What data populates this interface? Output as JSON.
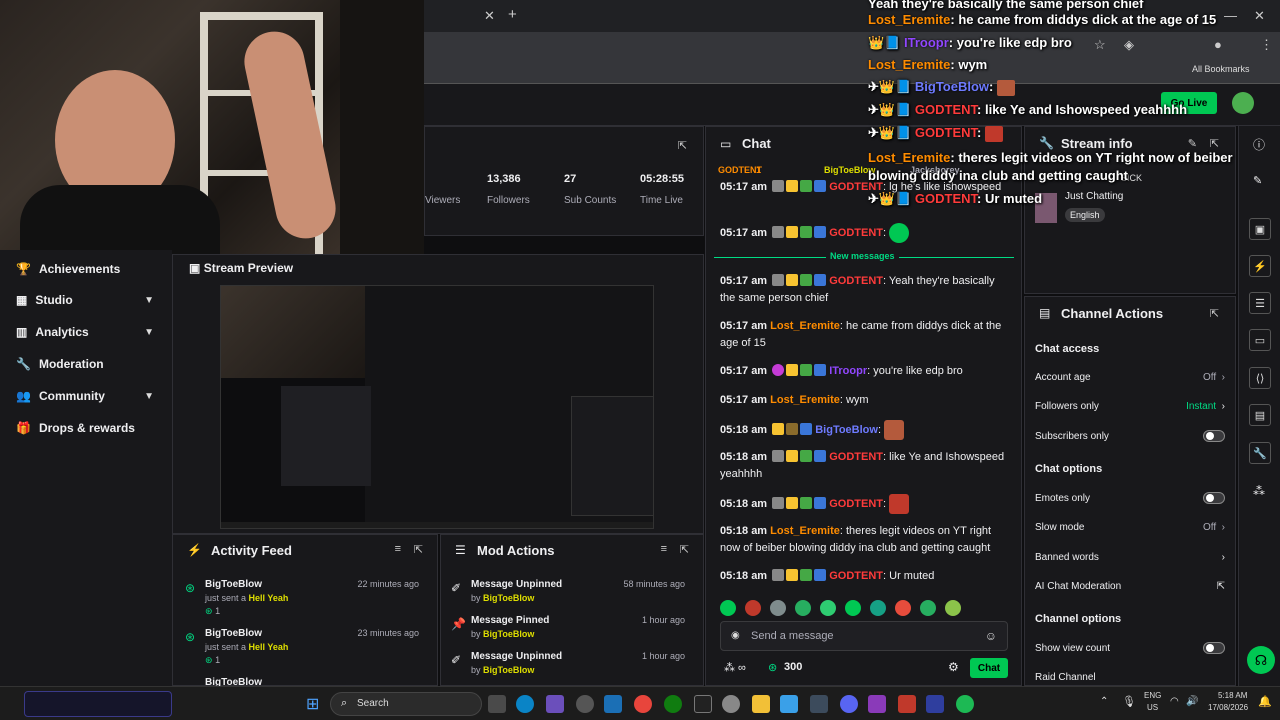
{
  "browser": {
    "bookmarks_label": "All Bookmarks",
    "go_live_label": "Go Live"
  },
  "sidebar": {
    "items": [
      {
        "label": "Achievements",
        "icon": "trophy-icon"
      },
      {
        "label": "Studio",
        "icon": "studio-icon"
      },
      {
        "label": "Analytics",
        "icon": "chart-icon"
      },
      {
        "label": "Moderation",
        "icon": "wrench-icon"
      },
      {
        "label": "Community",
        "icon": "people-icon"
      },
      {
        "label": "Drops & rewards",
        "icon": "gift-icon"
      }
    ]
  },
  "stats": {
    "viewers_label": "Viewers",
    "followers_value": "13,386",
    "followers_label": "Followers",
    "subs_value": "27",
    "subs_label": "Sub Counts",
    "time_value": "05:28:55",
    "time_label": "Time Live"
  },
  "preview": {
    "title": "Stream Preview"
  },
  "activity_feed": {
    "title": "Activity Feed",
    "items": [
      {
        "name": "BigToeBlow",
        "action": "just sent a",
        "item": "Hell Yeah",
        "count": "1",
        "time": "22 minutes ago"
      },
      {
        "name": "BigToeBlow",
        "action": "just sent a",
        "item": "Hell Yeah",
        "count": "1",
        "time": "23 minutes ago"
      },
      {
        "name": "BigToeBlow",
        "action": "",
        "item": "",
        "count": "",
        "time": ""
      }
    ]
  },
  "mod_actions": {
    "title": "Mod Actions",
    "items": [
      {
        "action": "Message Unpinned",
        "by": "by",
        "user": "BigToeBlow",
        "time": "58 minutes ago"
      },
      {
        "action": "Message Pinned",
        "by": "by",
        "user": "BigToeBlow",
        "time": "1 hour ago"
      },
      {
        "action": "Message Unpinned",
        "by": "by",
        "user": "BigToeBlow",
        "time": "1 hour ago"
      }
    ]
  },
  "chat": {
    "title": "Chat",
    "pinned_users": [
      "GODTENT",
      "1",
      "BigToeBlow",
      "Jackshorey"
    ],
    "new_messages_label": "New messages",
    "messages": [
      {
        "time": "05:17 am",
        "user": "GODTENT",
        "text": "lg he's like ishowspeed"
      },
      {
        "time": "05:17 am",
        "user": "GODTENT",
        "text": ""
      },
      {
        "time": "05:17 am",
        "user": "GODTENT",
        "text": "Yeah they're basically the same person chief"
      },
      {
        "time": "05:17 am",
        "user": "Lost_Eremite",
        "text": "he came from diddys dick at the age of 15"
      },
      {
        "time": "05:17 am",
        "user": "ITroopr",
        "text": "you're like edp bro"
      },
      {
        "time": "05:17 am",
        "user": "Lost_Eremite",
        "text": "wym"
      },
      {
        "time": "05:18 am",
        "user": "BigToeBlow",
        "text": ""
      },
      {
        "time": "05:18 am",
        "user": "GODTENT",
        "text": "like Ye and Ishowspeed yeahhhh"
      },
      {
        "time": "05:18 am",
        "user": "GODTENT",
        "text": ""
      },
      {
        "time": "05:18 am",
        "user": "Lost_Eremite",
        "text": "theres legit videos on YT right now of beiber blowing diddy ina club and getting caught"
      },
      {
        "time": "05:18 am",
        "user": "GODTENT",
        "text": "Ur muted"
      }
    ],
    "input_placeholder": "Send a message",
    "points": "300",
    "send_label": "Chat"
  },
  "overlay": {
    "lines": [
      {
        "user": "",
        "text": "Yeah they're basically the same person chief"
      },
      {
        "user": "Lost_Eremite",
        "text": "he came from diddys dick at the age of 15"
      },
      {
        "user": "ITroopr",
        "text": "you're like edp bro"
      },
      {
        "user": "Lost_Eremite",
        "text": "wym"
      },
      {
        "user": "BigToeBlow",
        "text": ""
      },
      {
        "user": "GODTENT",
        "text": "like Ye and Ishowspeed yeahhhh"
      },
      {
        "user": "GODTENT",
        "text": ""
      },
      {
        "user": "Lost_Eremite",
        "text": "theres legit videos on YT right now of beiber"
      },
      {
        "user": "",
        "text": "blowing diddy ina club and getting caught"
      },
      {
        "user": "GODTENT",
        "text": "Ur muted"
      }
    ]
  },
  "stream_info": {
    "title": "Stream info",
    "stream_title": "SICK",
    "category": "Just Chatting",
    "language": "English"
  },
  "channel_actions": {
    "title": "Channel Actions",
    "chat_access": "Chat access",
    "account_age_label": "Account age",
    "account_age_value": "Off",
    "followers_only_label": "Followers only",
    "followers_only_value": "Instant",
    "subscribers_only_label": "Subscribers only",
    "chat_options": "Chat options",
    "emotes_only_label": "Emotes only",
    "slow_mode_label": "Slow mode",
    "slow_mode_value": "Off",
    "banned_words_label": "Banned words",
    "ai_moderation_label": "AI Chat Moderation",
    "channel_options": "Channel options",
    "show_view_count_label": "Show view count",
    "raid_channel_label": "Raid Channel"
  },
  "taskbar": {
    "search_label": "Search",
    "lang_top": "ENG",
    "lang_bottom": "US",
    "time": "5:18 AM",
    "date": "17/08/2026"
  },
  "colors": {
    "accent_green": "#00db84",
    "godtent": "#ff3b3b",
    "lost": "#ff8c00"
  }
}
